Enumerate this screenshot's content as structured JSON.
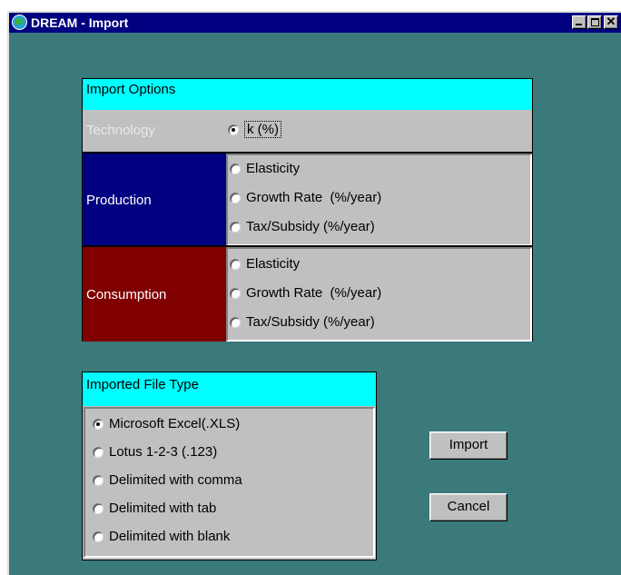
{
  "window": {
    "title": "DREAM - Import",
    "icon": "globe-icon",
    "controls": {
      "minimize": "minimize-icon",
      "maximize": "maximize-icon",
      "close": "✕"
    }
  },
  "import_options": {
    "header": "Import Options",
    "technology": {
      "label": "Technology",
      "option": "k (%)",
      "checked": true
    },
    "production": {
      "label": "Production",
      "options": [
        "Elasticity",
        "Growth Rate  (%/year)",
        "Tax/Subsidy (%/year)"
      ]
    },
    "consumption": {
      "label": "Consumption",
      "options": [
        "Elasticity",
        "Growth Rate  (%/year)",
        "Tax/Subsidy (%/year)"
      ]
    }
  },
  "file_type": {
    "header": "Imported File Type",
    "options": [
      "Microsoft Excel(.XLS)",
      "Lotus 1-2-3 (.123)",
      "Delimited with comma",
      "Delimited with tab",
      "Delimited with blank"
    ],
    "selected": "Microsoft Excel(.XLS)"
  },
  "buttons": {
    "import": "Import",
    "cancel": "Cancel"
  },
  "colors": {
    "background": "#3a7a7a",
    "header": "#00ffff",
    "production": "#000080",
    "consumption": "#800000",
    "titlebar": "#000080"
  }
}
